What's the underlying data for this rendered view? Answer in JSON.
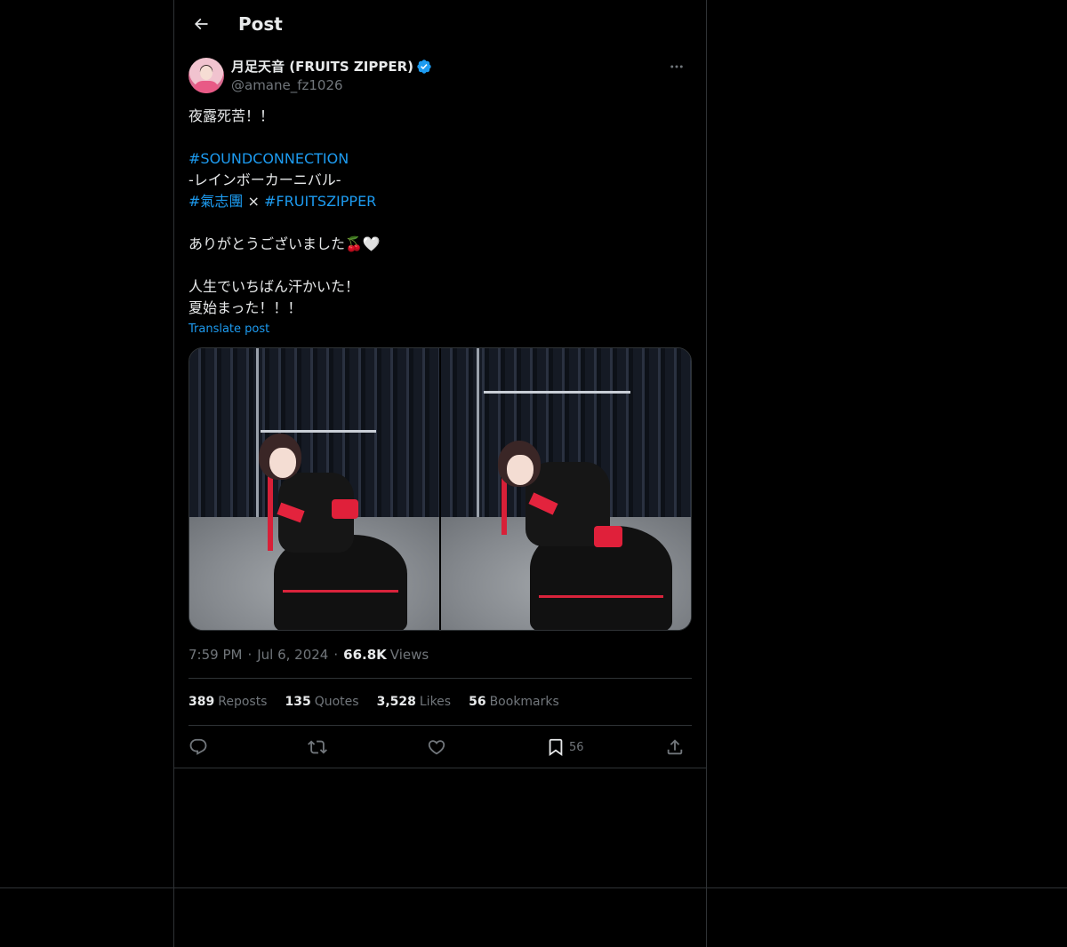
{
  "header": {
    "title": "Post",
    "back_icon": "arrow-left-icon"
  },
  "author": {
    "display_name": "月足天音 (FRUITS ZIPPER)",
    "handle": "@amane_fz1026",
    "verified": true,
    "verified_color": "#1d9bf0"
  },
  "post": {
    "lines": {
      "l1": "夜露死苦！！",
      "l3": "#SOUNDCONNECTION",
      "l4": "-レインボーカーニバル-",
      "l5_tag1": "#氣志團",
      "l5_sep": " × ",
      "l5_tag2": "#FRUITSZIPPER",
      "l7": "ありがとうございました🍒🤍",
      "l9": "人生でいちばん汗かいた！",
      "l10": "夏始まった！！！"
    },
    "translate_label": "Translate post"
  },
  "meta": {
    "time": "7:59 PM",
    "separator": "·",
    "date": "Jul 6, 2024",
    "views_count": "66.8K",
    "views_label": "Views"
  },
  "stats": {
    "reposts_count": "389",
    "reposts_label": "Reposts",
    "quotes_count": "135",
    "quotes_label": "Quotes",
    "likes_count": "3,528",
    "likes_label": "Likes",
    "bookmarks_count": "56",
    "bookmarks_label": "Bookmarks"
  },
  "actions": {
    "reply_icon": "reply-icon",
    "repost_icon": "repost-icon",
    "like_icon": "heart-icon",
    "bookmark_icon": "bookmark-icon",
    "bookmark_count": "56",
    "share_icon": "share-icon"
  },
  "colors": {
    "background": "#000000",
    "text": "#e7e9ea",
    "muted": "#71767b",
    "accent": "#1d9bf0",
    "border": "#2f3336"
  }
}
